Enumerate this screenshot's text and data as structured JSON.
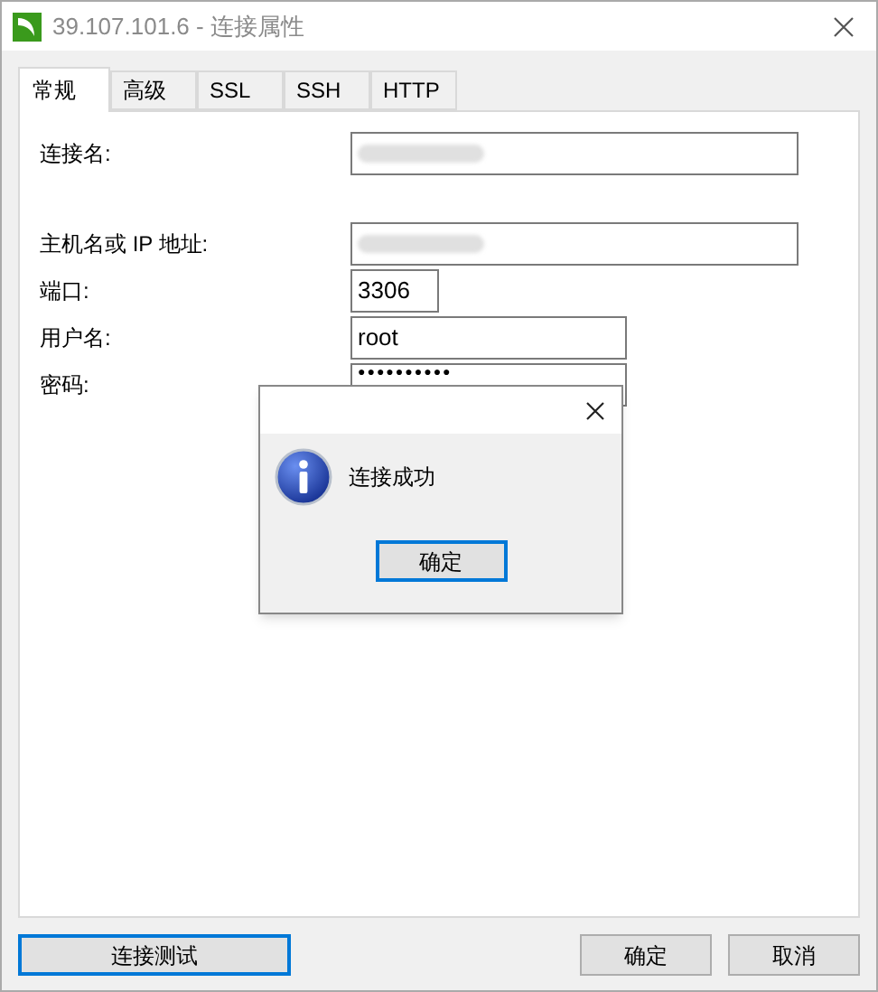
{
  "window": {
    "title": "39.107.101.6 - 连接属性"
  },
  "tabs": [
    {
      "label": "常规",
      "selected": true
    },
    {
      "label": "高级",
      "selected": false
    },
    {
      "label": "SSL",
      "selected": false
    },
    {
      "label": "SSH",
      "selected": false
    },
    {
      "label": "HTTP",
      "selected": false
    }
  ],
  "form": [
    {
      "label": "连接名:",
      "kind": "blurred"
    },
    {
      "label": "主机名或 IP 地址:",
      "kind": "blurred"
    },
    {
      "label": "端口:",
      "kind": "text",
      "value": "3306"
    },
    {
      "label": "用户名:",
      "kind": "text",
      "value": "root"
    },
    {
      "label": "密码:",
      "kind": "password",
      "value": "●●●●●●●●●●"
    }
  ],
  "message_box": {
    "message": "连接成功",
    "button": "确定"
  },
  "footer": {
    "test_button": "连接测试",
    "ok_button": "确定",
    "cancel_button": "取消"
  }
}
